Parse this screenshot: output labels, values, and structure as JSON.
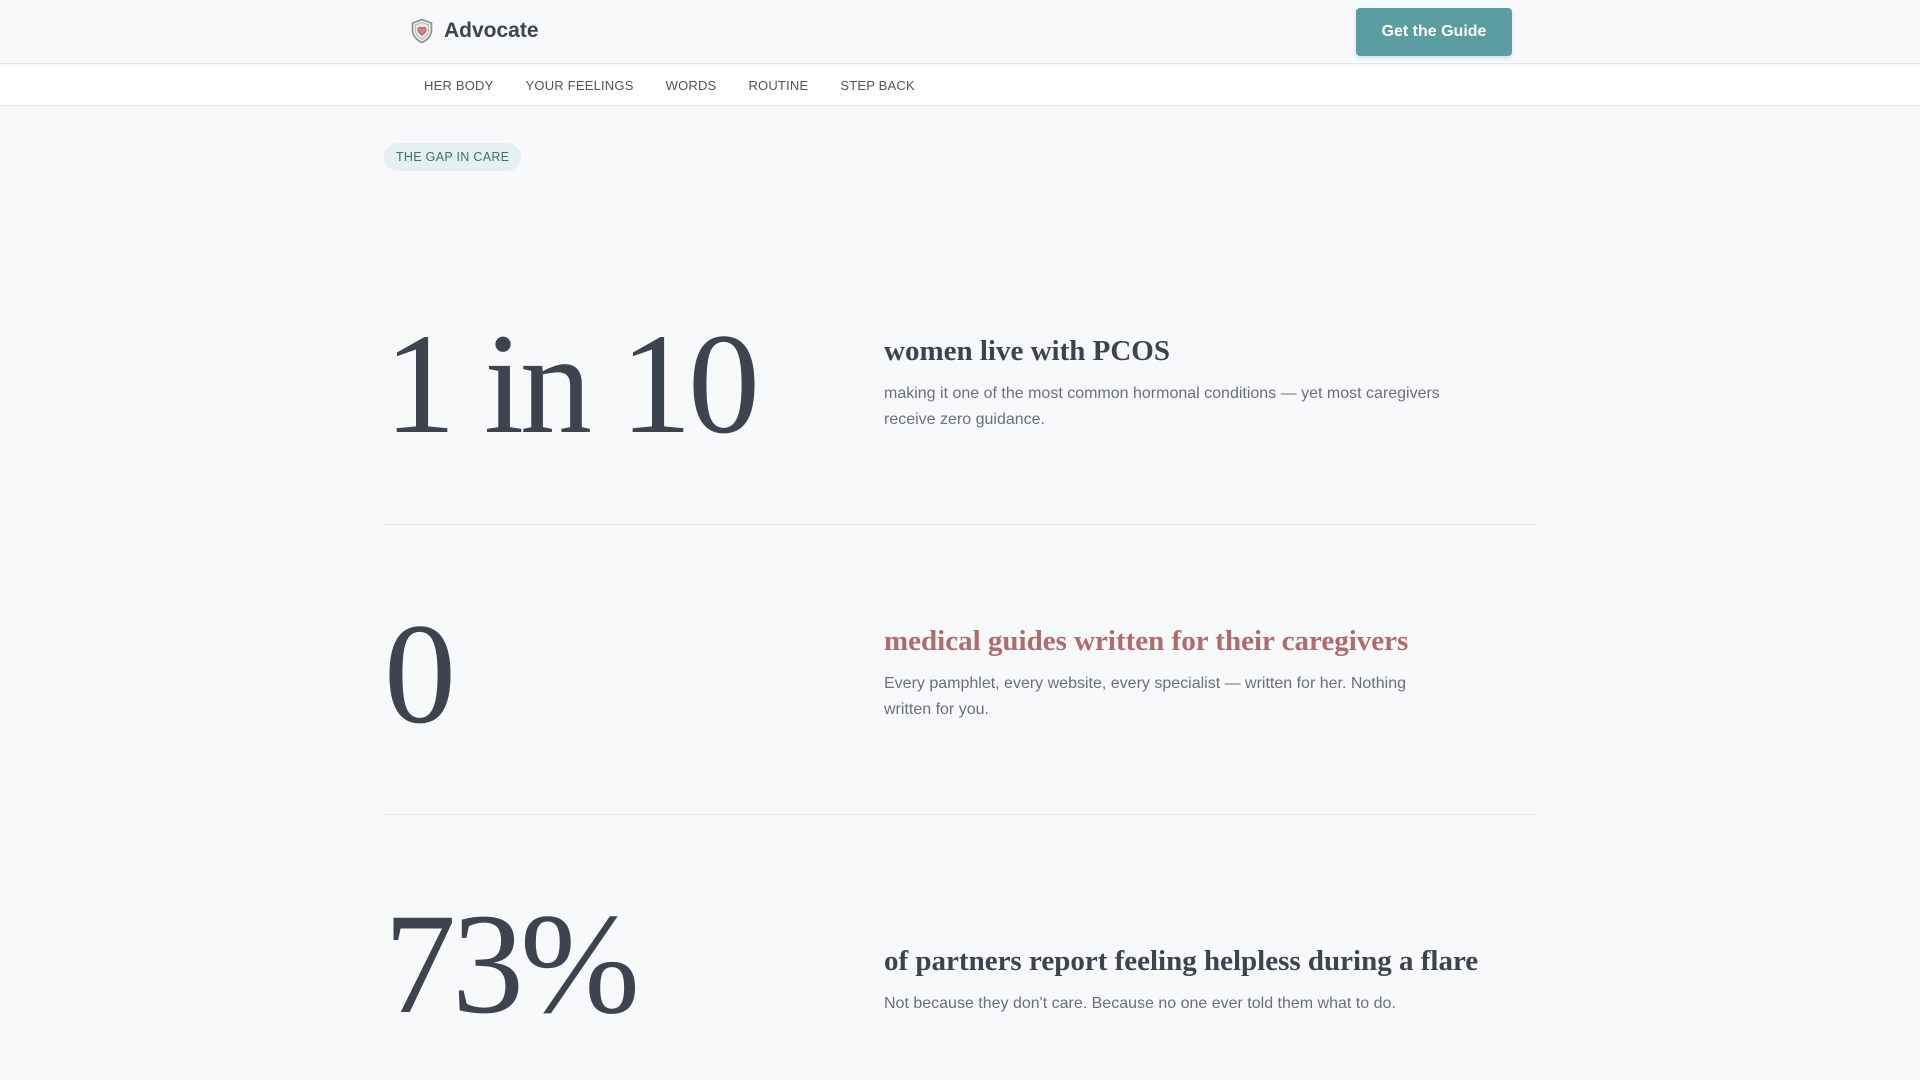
{
  "header": {
    "brand_name": "Advocate",
    "brand_icon": "shield-heart-icon",
    "cta_label": "Get the Guide"
  },
  "nav": {
    "items": [
      {
        "label": "HER BODY"
      },
      {
        "label": "YOUR FEELINGS"
      },
      {
        "label": "WORDS"
      },
      {
        "label": "ROUTINE"
      },
      {
        "label": "STEP BACK"
      }
    ]
  },
  "section": {
    "tag": "THE GAP IN CARE"
  },
  "stats": [
    {
      "number": "1 in 10",
      "heading": "women live with PCOS",
      "body": "making it one of the most common hormonal conditions — yet most caregivers receive zero guidance."
    },
    {
      "number": "0",
      "heading": "medical guides written for their caregivers",
      "body": "Every pamphlet, every website, every specialist — written for her. Nothing written for you."
    },
    {
      "number": "73%",
      "heading": "of partners report feeling helpless during a flare",
      "body": "Not because they don't care. Because no one ever told them what to do."
    }
  ],
  "colors": {
    "accent_teal": "#5b9ea1",
    "accent_rose": "#b06c6c",
    "text_dark": "#3d4450",
    "background": "#f8f9fa"
  }
}
